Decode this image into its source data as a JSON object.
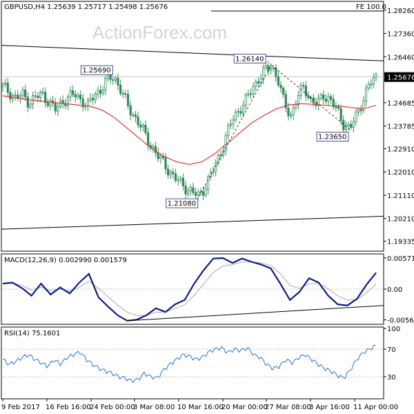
{
  "main_panel": {
    "title": "GBPUSD,H4  1.25639 1.25717 1.25498 1.25676",
    "fe_label": "FE 100.0",
    "watermark": "ActionForex.com",
    "current_price_label": "1.25676"
  },
  "macd_panel": {
    "title": "MACD(12,26,9) 0.002990 0.001579"
  },
  "rsi_panel": {
    "title": "RSI(14) 75.1601"
  },
  "colors": {
    "candle": "#2e8b57",
    "moving_average": "#e03030",
    "macd_line": "#0a1a8a",
    "macd_signal": "#aaaaaa",
    "rsi_line": "#1e6fe0",
    "trend_lines": "#000000",
    "level_lines": "#c0c0c0"
  },
  "chart_data": [
    {
      "panel": "price",
      "type": "candlestick",
      "ylim": [
        1.1895,
        1.286
      ],
      "y_ticks": [
        "1.28260",
        "1.27360",
        "1.26460",
        "1.25676",
        "1.24685",
        "1.23785",
        "1.22910",
        "1.22010",
        "1.21110",
        "1.20210",
        "1.19335"
      ],
      "y_tick_values": [
        1.2826,
        1.2736,
        1.2646,
        1.25676,
        1.24685,
        1.23785,
        1.2291,
        1.2201,
        1.2111,
        1.2021,
        1.19335
      ],
      "x_tick_labels": [
        "9 Feb 2017",
        "16 Feb 16:00",
        "24 Feb 00:00",
        "3 Mar 08:00",
        "10 Mar 16:00",
        "20 Mar 00:00",
        "27 Mar 08:00",
        "3 Apr 16:00",
        "11 Apr 00:00"
      ],
      "close_path": [
        1.253,
        1.251,
        1.2485,
        1.25,
        1.247,
        1.249,
        1.25,
        1.2475,
        1.244,
        1.247,
        1.249,
        1.25,
        1.248,
        1.2455,
        1.25,
        1.252,
        1.256,
        1.2569,
        1.252,
        1.246,
        1.242,
        1.238,
        1.233,
        1.229,
        1.225,
        1.222,
        1.2185,
        1.216,
        1.214,
        1.212,
        1.2108,
        1.215,
        1.22,
        1.226,
        1.233,
        1.24,
        1.244,
        1.247,
        1.252,
        1.256,
        1.259,
        1.2614,
        1.256,
        1.246,
        1.242,
        1.249,
        1.253,
        1.248,
        1.246,
        1.25,
        1.248,
        1.244,
        1.239,
        1.2365,
        1.242,
        1.248,
        1.254,
        1.2568
      ],
      "labels": [
        {
          "text": "1.25690",
          "value": 1.2569
        },
        {
          "text": "1.26140",
          "value": 1.2614
        },
        {
          "text": "1.21080",
          "value": 1.2108
        },
        {
          "text": "1.23650",
          "value": 1.2365
        }
      ],
      "horizontal_levels": [
        1.2569
      ],
      "trend_line_upper": [
        1.269,
        1.263
      ],
      "trend_line_lower": [
        1.198,
        1.203
      ],
      "moving_average": [
        1.2495,
        1.2488,
        1.248,
        1.2475,
        1.247,
        1.2465,
        1.246,
        1.2455,
        1.244,
        1.241,
        1.237,
        1.233,
        1.229,
        1.226,
        1.224,
        1.223,
        1.224,
        1.227,
        1.231,
        1.235,
        1.239,
        1.242,
        1.2445,
        1.246,
        1.2465,
        1.2462,
        1.2458,
        1.2456,
        1.245,
        1.2445,
        1.2458
      ]
    },
    {
      "panel": "macd",
      "type": "line",
      "ylim": [
        -0.0062,
        0.0062
      ],
      "y_ticks": [
        "0.005717",
        "0.00",
        "-0.005645"
      ],
      "y_tick_values": [
        0.005717,
        0.0,
        -0.005645
      ],
      "macd_path": [
        0.001,
        0.0012,
        0.0002,
        -0.0012,
        0.001,
        -0.001,
        0.0003,
        -0.0008,
        0.0012,
        0.0028,
        -0.0015,
        -0.0032,
        -0.0048,
        -0.0058,
        -0.0056,
        -0.0048,
        -0.0035,
        -0.0042,
        -0.0028,
        -0.002,
        0.001,
        0.0035,
        0.0056,
        0.0057,
        0.0048,
        0.0056,
        0.005,
        0.0045,
        0.0038,
        0.001,
        -0.002,
        -0.0005,
        0.002,
        0.0012,
        -0.0012,
        -0.0028,
        -0.003,
        -0.0018,
        0.0008,
        0.003
      ],
      "trend_line": [
        -0.0058,
        -0.003
      ]
    },
    {
      "panel": "rsi",
      "type": "line",
      "ylim": [
        0,
        100
      ],
      "y_ticks": [
        "100",
        "70",
        "30",
        "0"
      ],
      "y_tick_values": [
        100,
        70,
        30,
        0
      ],
      "levels": [
        70,
        30
      ],
      "rsi_path": [
        55,
        48,
        52,
        58,
        62,
        55,
        50,
        45,
        55,
        48,
        58,
        62,
        66,
        55,
        48,
        42,
        38,
        35,
        30,
        28,
        24,
        26,
        35,
        30,
        28,
        40,
        48,
        55,
        62,
        60,
        55,
        58,
        66,
        70,
        72,
        65,
        70,
        68,
        72,
        62,
        58,
        48,
        42,
        45,
        55,
        50,
        58,
        62,
        55,
        48,
        42,
        38,
        32,
        28,
        40,
        55,
        65,
        70,
        75
      ]
    }
  ]
}
